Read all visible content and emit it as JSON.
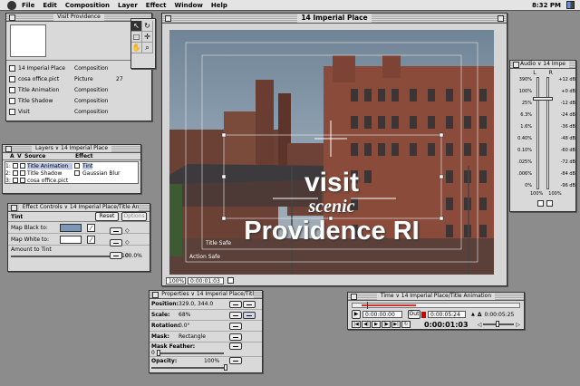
{
  "menubar": {
    "items": [
      "File",
      "Edit",
      "Composition",
      "Layer",
      "Effect",
      "Window",
      "Help"
    ],
    "clock": "8:32 PM"
  },
  "project": {
    "title": "Visit Providence",
    "items": [
      {
        "name": "14 Imperial Place",
        "type": "Composition",
        "extra": ""
      },
      {
        "name": "cosa office.pict",
        "type": "Picture",
        "extra": "27"
      },
      {
        "name": "Title Animation",
        "type": "Composition",
        "extra": ""
      },
      {
        "name": "Title Shadow",
        "type": "Composition",
        "extra": ""
      },
      {
        "name": "Visit",
        "type": "Composition",
        "extra": ""
      }
    ]
  },
  "tools": [
    "pointer-tool",
    "rotate-tool",
    "rect-mask-tool",
    "pan-behind-tool",
    "hand-tool",
    "zoom-tool"
  ],
  "comp": {
    "title": "14 Imperial Place",
    "line1": "visit",
    "line2": "scenic",
    "line3": "Providence RI",
    "title_safe": "Title Safe",
    "action_safe": "Action Safe",
    "zoom": "100%",
    "timecode": "0:00:01:03"
  },
  "layers": {
    "title": "Layers ∨ 14 Imperial Place",
    "col_a": "A",
    "col_v": "V",
    "col_source": "Source",
    "col_effect": "Effect",
    "rows": [
      {
        "num": "1:",
        "source": "Title Animation",
        "effect": "Tint"
      },
      {
        "num": "2:",
        "source": "Title Shadow",
        "effect": "Gaussian Blur"
      },
      {
        "num": "3:",
        "source": "cosa office.pict",
        "effect": ""
      }
    ]
  },
  "effect_controls": {
    "title": "Effect Controls ∨ 14 Imperial Place/Title Animat",
    "effect_name": "Tint",
    "reset": "Reset",
    "options": "Options",
    "map_black": "Map Black to:",
    "map_white": "Map White to:",
    "amount_label": "Amount to Tint",
    "amount_value": "100.0%",
    "amount": 1.0
  },
  "audio": {
    "title": "Audio ∨ 14 Impe",
    "l": "L",
    "r": "R",
    "left_scale": [
      "390%",
      "100%",
      "25%",
      "6.3%",
      "1.6%",
      "0.40%",
      "0.10%",
      ".025%",
      ".006%",
      "0%"
    ],
    "right_scale": [
      "+12 dB",
      "+0 dB",
      "-12 dB",
      "-24 dB",
      "-36 dB",
      "-48 dB",
      "-60 dB",
      "-72 dB",
      "-84 dB",
      "-96 dB"
    ],
    "left_value": "100%",
    "right_value": "100%",
    "level": 0.82
  },
  "properties": {
    "title": "Properties ∨ 14 Imperial Place/Title",
    "position_label": "Position:",
    "position_value": "329.0, 344.0",
    "scale_label": "Scale:",
    "scale_value": "68%",
    "rotation_label": "Rotation:",
    "rotation_value": "0.0°",
    "mask_label": "Mask:",
    "mask_value": "Rectangle",
    "mask_feather_label": "Mask Feather:",
    "mask_feather_value": "0",
    "opacity_label": "Opacity:",
    "opacity_value": "100%",
    "opacity": 1.0
  },
  "time_layout": {
    "title": "Time ∨ 14 Imperial Place/Title Animation",
    "in_time": "0:00:00:00",
    "out_label": "Out",
    "out_time": "0:00:05:24",
    "duration": "0:00:05:25",
    "current": "0:00:01:03",
    "delta_icon": "Δ",
    "triangle_icon": "▲"
  }
}
